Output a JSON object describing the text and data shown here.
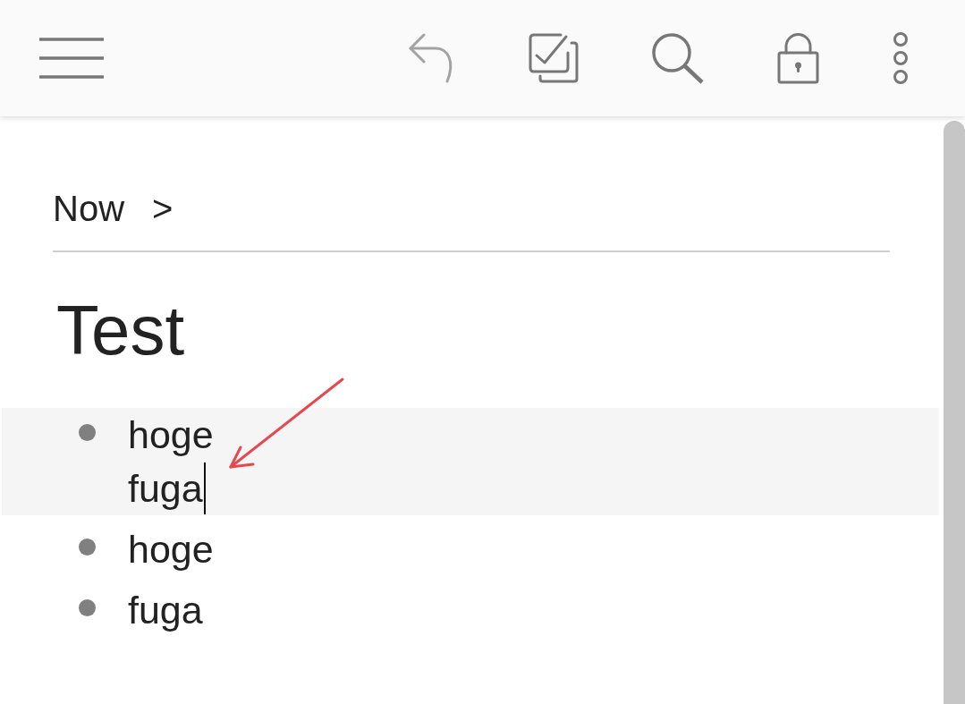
{
  "toolbar": {
    "actions": [
      {
        "kind": "undo",
        "disabled": true
      },
      {
        "kind": "tasks",
        "disabled": false
      },
      {
        "kind": "search",
        "disabled": false
      },
      {
        "kind": "lock",
        "disabled": false
      },
      {
        "kind": "more",
        "disabled": false
      }
    ]
  },
  "breadcrumb": {
    "label": "Now",
    "separator": ">"
  },
  "title": "Test",
  "items": [
    {
      "lines": [
        "hoge",
        "fuga"
      ],
      "selected": true
    },
    {
      "lines": [
        "hoge"
      ],
      "selected": false
    },
    {
      "lines": [
        "fuga"
      ],
      "selected": false
    }
  ]
}
